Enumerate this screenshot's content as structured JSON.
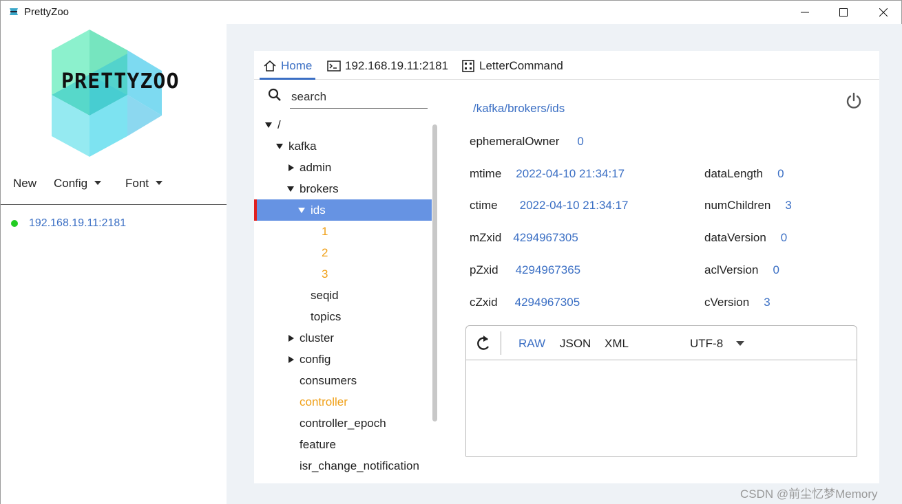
{
  "window": {
    "title": "PrettyZoo",
    "minimize": "—",
    "maximize": "☐",
    "close": "✕"
  },
  "logo": {
    "text": "PRETTYZOO"
  },
  "menu": {
    "new_label": "New",
    "config_label": "Config",
    "font_label": "Font"
  },
  "servers": [
    {
      "host": "192.168.19.11:2181",
      "status": "connected",
      "status_color": "#22cc22"
    }
  ],
  "tabs": [
    {
      "label": "Home",
      "icon": "home-icon",
      "active": true
    },
    {
      "label": "192.168.19.11:2181",
      "icon": "terminal-icon"
    },
    {
      "label": "LetterCommand",
      "icon": "dice-icon"
    }
  ],
  "search": {
    "placeholder": "search",
    "value": ""
  },
  "tree": [
    {
      "label": "/",
      "expand": "down"
    },
    {
      "label": "kafka",
      "expand": "down"
    },
    {
      "label": "admin",
      "expand": "right"
    },
    {
      "label": "brokers",
      "expand": "down"
    },
    {
      "label": "ids",
      "expand": "down",
      "selected": true
    },
    {
      "label": "1",
      "ephemeral": true
    },
    {
      "label": "2",
      "ephemeral": true
    },
    {
      "label": "3",
      "ephemeral": true
    },
    {
      "label": "seqid"
    },
    {
      "label": "topics"
    },
    {
      "label": "cluster",
      "expand": "right"
    },
    {
      "label": "config",
      "expand": "right"
    },
    {
      "label": "consumers"
    },
    {
      "label": "controller",
      "ephemeral": true
    },
    {
      "label": "controller_epoch"
    },
    {
      "label": "feature"
    },
    {
      "label": "isr_change_notification"
    }
  ],
  "node": {
    "path": "/kafka/brokers/ids",
    "ephemeralOwner": {
      "label": "ephemeralOwner",
      "value": "0"
    },
    "mtime": {
      "label": "mtime",
      "value": "2022-04-10 21:34:17"
    },
    "ctime": {
      "label": "ctime",
      "value": "2022-04-10 21:34:17"
    },
    "mZxid": {
      "label": "mZxid",
      "value": "4294967305"
    },
    "pZxid": {
      "label": "pZxid",
      "value": "4294967365"
    },
    "cZxid": {
      "label": "cZxid",
      "value": "4294967305"
    },
    "dataLength": {
      "label": "dataLength",
      "value": "0"
    },
    "numChildren": {
      "label": "numChildren",
      "value": "3"
    },
    "dataVersion": {
      "label": "dataVersion",
      "value": "0"
    },
    "aclVersion": {
      "label": "aclVersion",
      "value": "0"
    },
    "cVersion": {
      "label": "cVersion",
      "value": "3"
    }
  },
  "editor": {
    "formats": [
      "RAW",
      "JSON",
      "XML"
    ],
    "active_format": "RAW",
    "encoding": "UTF-8",
    "content": ""
  },
  "watermark": "CSDN @前尘忆梦Memory",
  "colors": {
    "accent": "#3b6fc4",
    "selected_row": "#6693e3",
    "ephemeral": "#f0a018",
    "selection_marker": "#e02020"
  }
}
